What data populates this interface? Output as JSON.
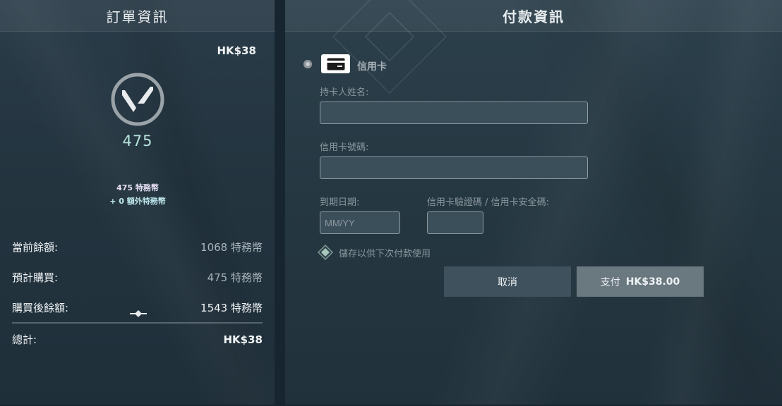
{
  "order": {
    "header": "訂單資訊",
    "price": "HK$38",
    "vp_icon": "valorant-points-icon",
    "vp_amount": "475",
    "vp_line1": "475 特務幣",
    "vp_line2": "+ 0 額外特務幣",
    "summary": {
      "current_label": "當前餘額:",
      "current_value": "1068 特務幣",
      "planned_label": "預計購買:",
      "planned_value": "475 特務幣",
      "after_label": "購買後餘額:",
      "after_value": "1543 特務幣",
      "total_label": "總計:",
      "total_value": "HK$38"
    }
  },
  "payment": {
    "header": "付款資訊",
    "method_label": "信用卡",
    "method_icon": "credit-card-icon",
    "cardholder_label": "持卡人姓名:",
    "cardholder_value": "",
    "card_number_label": "信用卡號碼:",
    "card_number_value": "",
    "expiry_label": "到期日期:",
    "expiry_placeholder": "MM/YY",
    "cvv_label": "信用卡驗證碼 / 信用卡安全碼:",
    "save_label": "儲存以供下次付款使用",
    "cancel_label": "取消",
    "pay_label": "支付",
    "pay_amount": "HK$38.00"
  },
  "colors": {
    "accent_vp": "#b8e3dd",
    "panel_left": "#23343f",
    "panel_right": "#253741",
    "pay_button": "#6a7880",
    "cancel_button": "#3e515d"
  }
}
